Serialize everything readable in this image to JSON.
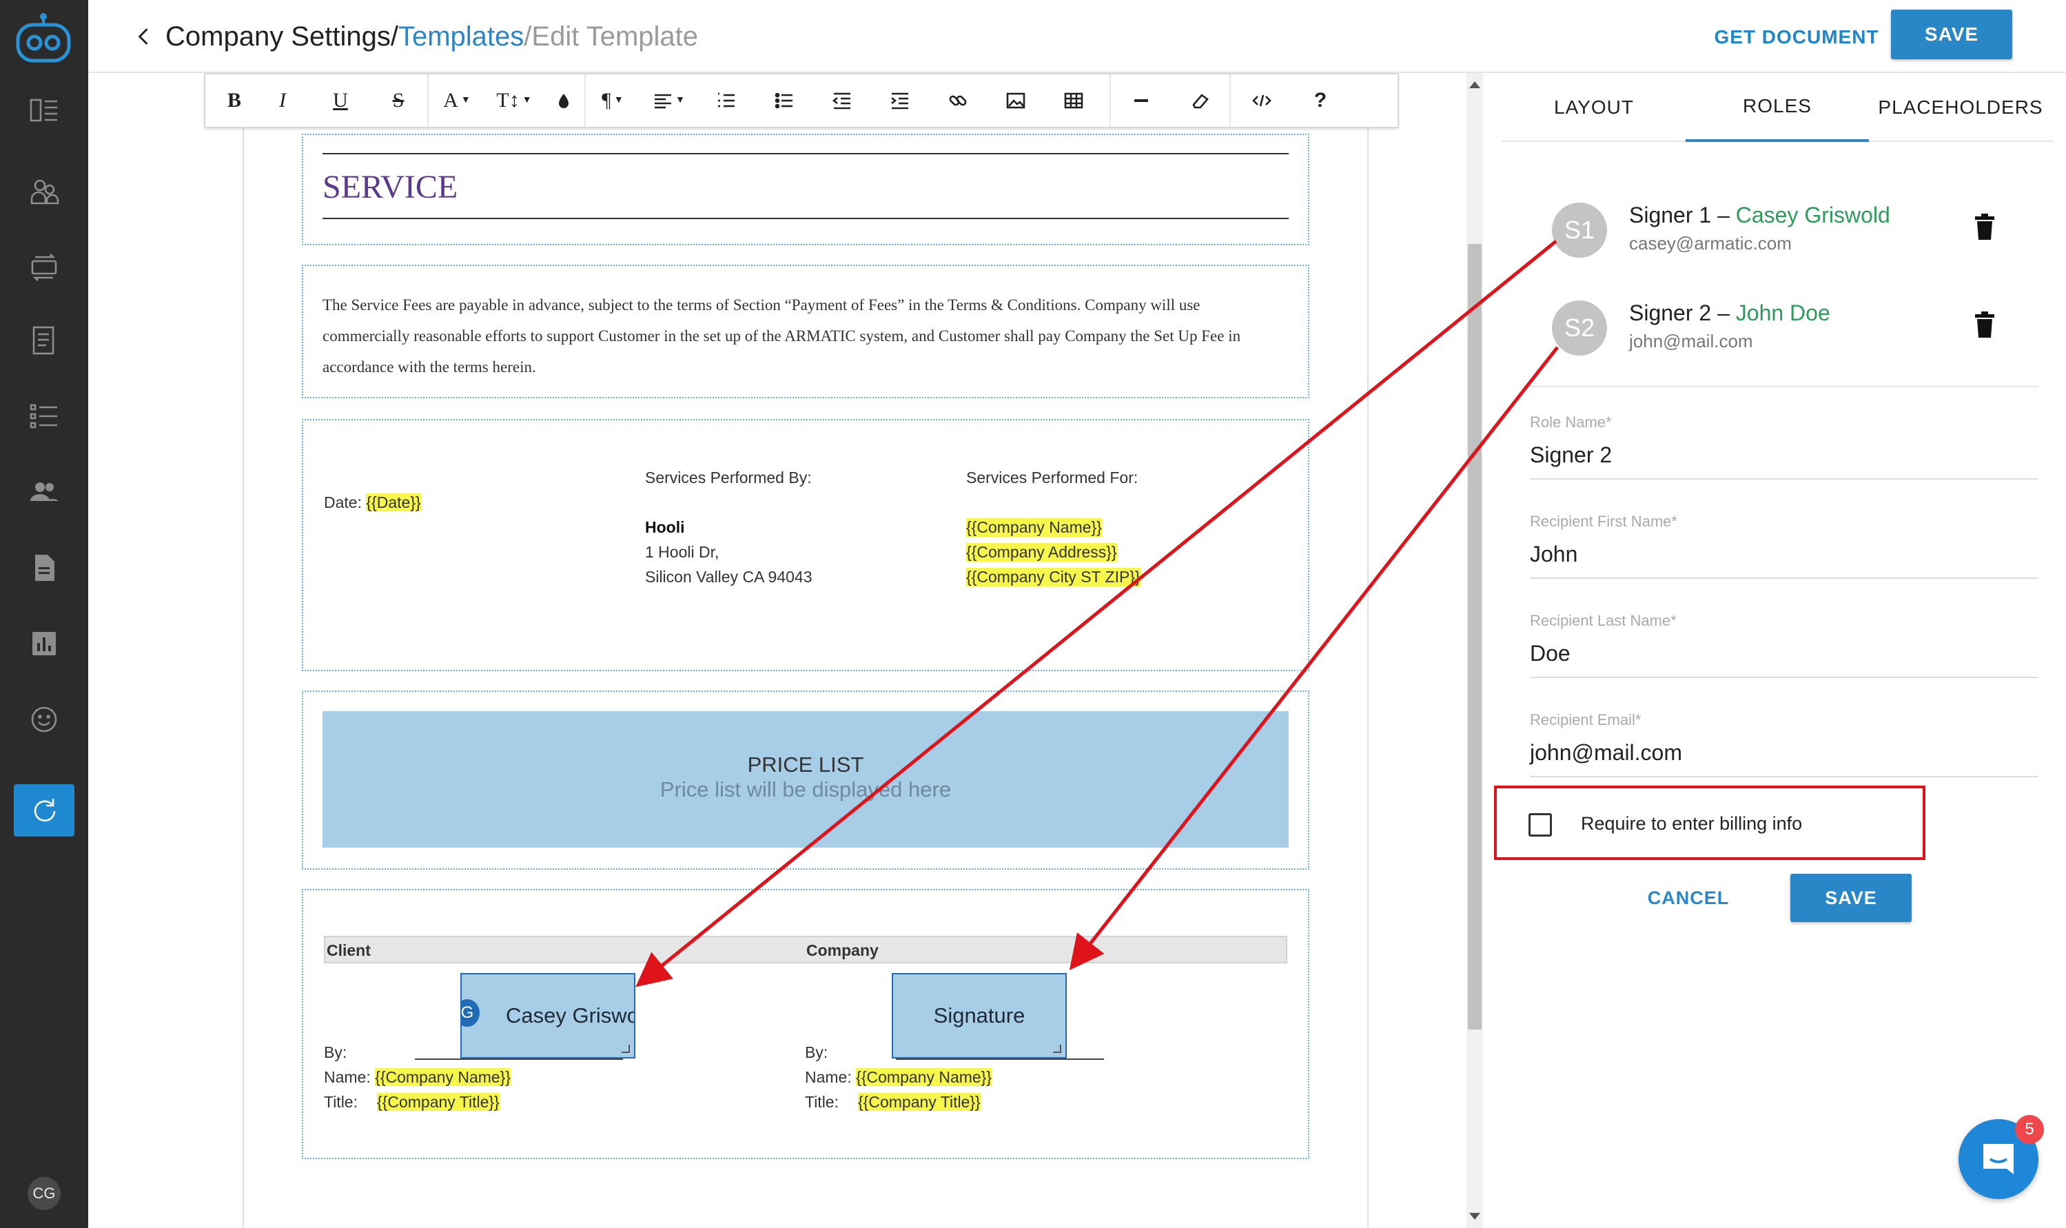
{
  "header": {
    "crumb1": "Company Settings",
    "sep1": "/",
    "crumb2": "Templates",
    "crumb3": "/Edit Template",
    "get_document": "GET DOCUMENT",
    "save": "SAVE"
  },
  "sidebar": {
    "user_initials": "CG"
  },
  "toolbar": {
    "bold": "B",
    "italic": "I",
    "underline": "U",
    "strike": "S",
    "font": "A",
    "size": "T↕",
    "help": "?"
  },
  "document": {
    "service_title": "SERVICE",
    "service_paragraph": "The Service Fees are payable in advance, subject to the terms of Section “Payment of Fees” in the Terms & Conditions. Company will use commercially reasonable efforts to support Customer in the set up of the ARMATIC system, and Customer shall pay Company the Set Up Fee in accordance with the terms herein.",
    "date_label": "Date:",
    "date_value": "{{Date}}",
    "performed_by_label": "Services Performed By:",
    "performed_for_label": "Services Performed For:",
    "provider_name": "Hooli",
    "provider_address": "1 Hooli Dr,",
    "provider_city": "Silicon Valley CA 94043",
    "client_company_name": "{{Company Name}}",
    "client_company_address": "{{Company Address}}",
    "client_company_city": "{{Company City ST ZIP}}",
    "price_list_title": "PRICE LIST",
    "price_list_sub": "Price list will be displayed here",
    "client_col": "Client",
    "company_col": "Company",
    "client_sig_text": "Casey Griswold",
    "client_sig_initial": "G",
    "company_sig_text": "Signature",
    "by_label": "By:",
    "name_label": "Name:",
    "title_label": "Title:",
    "name_value": "{{Company Name}}",
    "title_value": "{{Company Title}}"
  },
  "panel": {
    "tabs": [
      "LAYOUT",
      "ROLES",
      "PLACEHOLDERS"
    ],
    "active_tab": "ROLES",
    "signers": [
      {
        "initials": "S1",
        "label": "Signer 1 – ",
        "name": "Casey Griswold",
        "email": "casey@armatic.com"
      },
      {
        "initials": "S2",
        "label": "Signer 2 – ",
        "name": "John Doe",
        "email": "john@mail.com"
      }
    ],
    "fields": [
      {
        "label": "Role Name*",
        "value": "Signer 2"
      },
      {
        "label": "Recipient First Name*",
        "value": "John"
      },
      {
        "label": "Recipient Last Name*",
        "value": "Doe"
      },
      {
        "label": "Recipient Email*",
        "value": "john@mail.com"
      }
    ],
    "billing_label": "Require to enter billing info",
    "billing_checked": false,
    "cancel": "CANCEL",
    "save": "SAVE"
  },
  "chat": {
    "badge_count": "5"
  },
  "colors": {
    "accent": "#2986c7",
    "signer_name": "#2e9a5c",
    "highlight": "#f7f74b",
    "annotation": "#e0131a"
  }
}
